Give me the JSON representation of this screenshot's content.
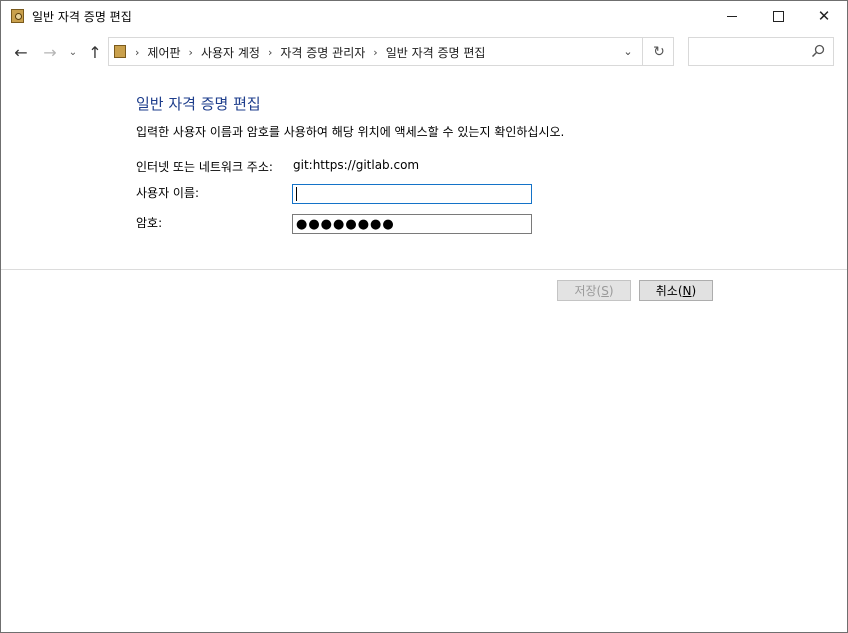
{
  "window": {
    "title": "일반 자격 증명 편집",
    "controls": {
      "minimize": "minimize",
      "maximize": "maximize",
      "close": "✕"
    }
  },
  "nav": {
    "back": "←",
    "forward": "→",
    "recent": "⌄",
    "up": "↑",
    "dropdown": "⌄",
    "refresh": "↻",
    "breadcrumbs": [
      "제어판",
      "사용자 계정",
      "자격 증명 관리자",
      "일반 자격 증명 편집"
    ],
    "search_placeholder": ""
  },
  "form": {
    "heading": "일반 자격 증명 편집",
    "description": "입력한 사용자 이름과 암호를 사용하여 해당 위치에 액세스할 수 있는지 확인하십시오.",
    "address_label": "인터넷 또는 네트워크 주소:",
    "address_value": "git:https://gitlab.com",
    "username_label": "사용자 이름:",
    "username_value": "",
    "password_label": "암호:",
    "password_value": "●●●●●●●●"
  },
  "buttons": {
    "save_label": "저장",
    "save_key": "S",
    "cancel_label": "취소",
    "cancel_key": "N"
  },
  "colors": {
    "heading": "#1e3e8c",
    "focus_border": "#1473c8",
    "disabled_text": "#9a9a9a"
  },
  "icons": {
    "app": "credential-manager-icon",
    "search": "search-icon"
  }
}
